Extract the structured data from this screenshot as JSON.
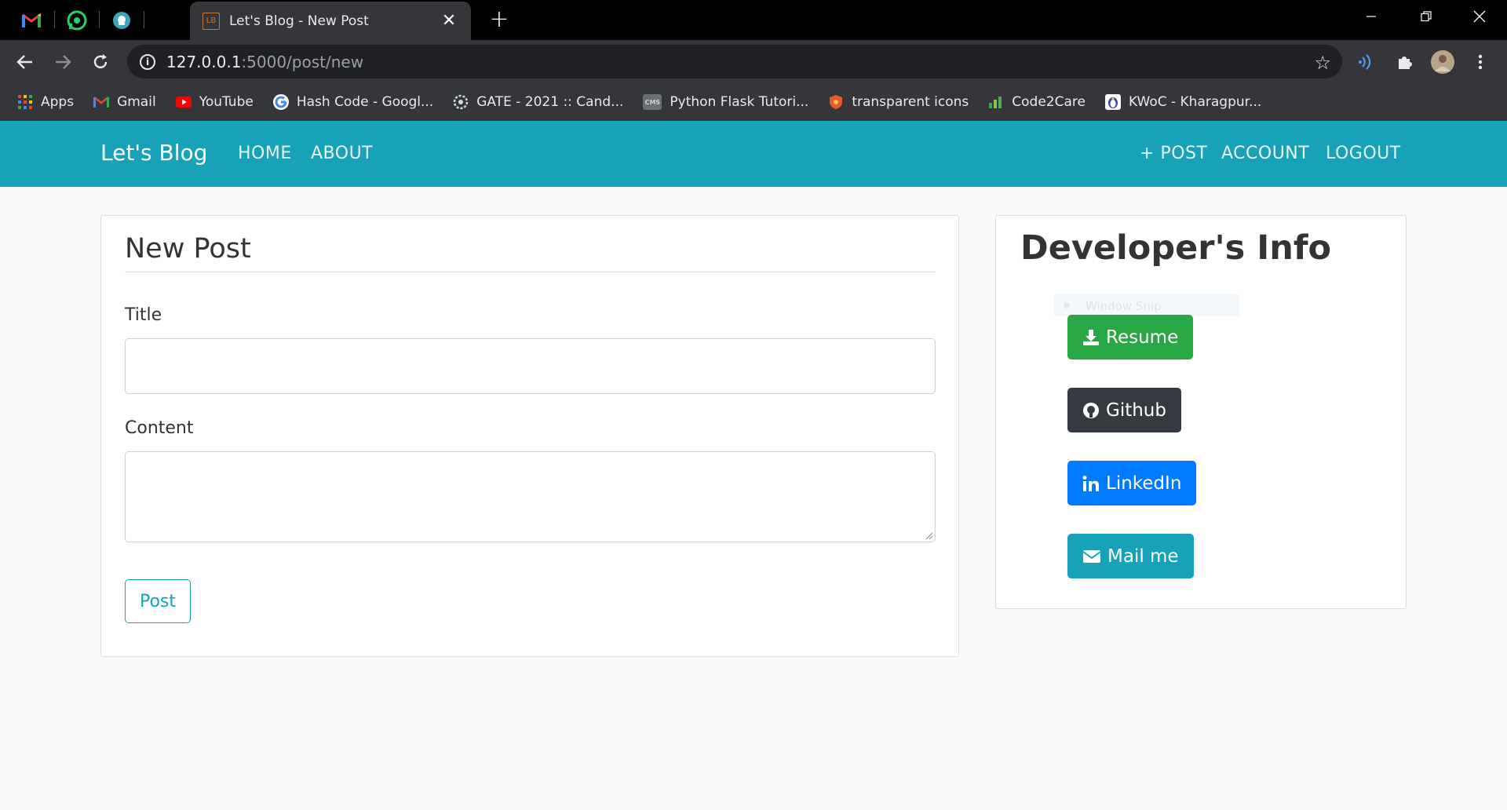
{
  "browser": {
    "tab_title": "Let's Blog - New Post",
    "tab_favicon_text": "LB",
    "url_host": "127.0.0.1",
    "url_path": ":5000/post/new",
    "pinned_tabs": [
      "gmail-icon",
      "whatsapp-icon",
      "extension-icon"
    ],
    "bookmarks": [
      {
        "label": "Apps",
        "icon": "apps-grid-icon"
      },
      {
        "label": "Gmail",
        "icon": "gmail-icon"
      },
      {
        "label": "YouTube",
        "icon": "youtube-icon"
      },
      {
        "label": "Hash Code - Googl...",
        "icon": "google-icon"
      },
      {
        "label": "GATE - 2021 :: Cand...",
        "icon": "gate-icon"
      },
      {
        "label": "Python Flask Tutori...",
        "icon": "cms-icon"
      },
      {
        "label": "transparent icons",
        "icon": "shield-icon"
      },
      {
        "label": "Code2Care",
        "icon": "chart-icon"
      },
      {
        "label": "KWoC - Kharagpur...",
        "icon": "penguin-icon"
      }
    ]
  },
  "navbar": {
    "brand": "Let's Blog",
    "left_links": [
      "HOME",
      "ABOUT"
    ],
    "right_links": [
      "+ POST",
      "ACCOUNT",
      "LOGOUT"
    ]
  },
  "form": {
    "legend": "New Post",
    "title_label": "Title",
    "title_value": "",
    "content_label": "Content",
    "content_value": "",
    "submit_label": "Post"
  },
  "sidebar": {
    "title": "Developer's Info",
    "overlay_text": "Window Snip",
    "buttons": [
      {
        "label": "Resume",
        "icon": "download-icon",
        "color": "#28a745"
      },
      {
        "label": "Github",
        "icon": "github-icon",
        "color": "#343a40"
      },
      {
        "label": "LinkedIn",
        "icon": "linkedin-icon",
        "color": "#007bff"
      },
      {
        "label": "Mail me",
        "icon": "envelope-icon",
        "color": "#17a2b8"
      }
    ]
  },
  "colors": {
    "navbar": "#17a2b8",
    "page_bg": "#fafafa"
  }
}
